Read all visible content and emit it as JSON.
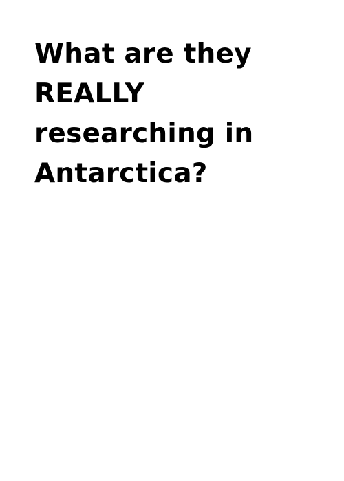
{
  "headline": {
    "lines": [
      "What are they",
      "REALLY",
      "researching in",
      "Antarctica?"
    ]
  },
  "colors": {
    "background": "#ffffff",
    "text": "#000000"
  }
}
